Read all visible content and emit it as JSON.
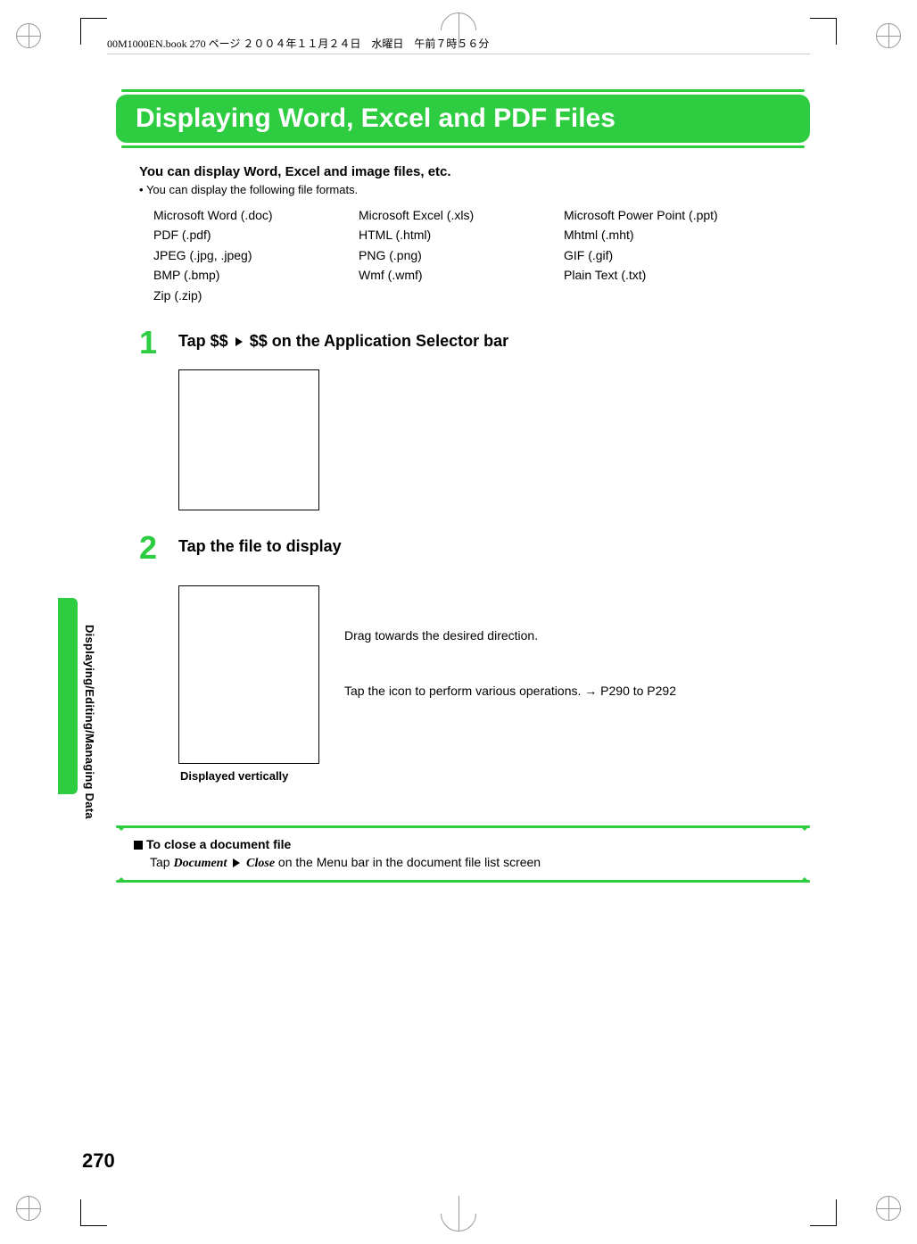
{
  "header": {
    "crop_text": "00M1000EN.book  270 ページ  ２００４年１１月２４日　水曜日　午前７時５６分"
  },
  "banner": {
    "title": "Displaying Word, Excel and PDF Files"
  },
  "intro": {
    "bold": "You can display Word, Excel and image files, etc.",
    "bullet_prefix": "•",
    "bullet_text": "You can display the following file formats."
  },
  "formats": {
    "col1": [
      "Microsoft Word (.doc)",
      "PDF (.pdf)",
      "JPEG (.jpg, .jpeg)",
      "BMP (.bmp)",
      "Zip (.zip)"
    ],
    "col2": [
      "Microsoft Excel (.xls)",
      "HTML (.html)",
      "PNG (.png)",
      "Wmf (.wmf)"
    ],
    "col3": [
      "Microsoft Power Point (.ppt)",
      "Mhtml (.mht)",
      "GIF (.gif)",
      "Plain Text (.txt)"
    ]
  },
  "steps": {
    "s1": {
      "num": "1",
      "pre": "Tap $$ ",
      "post": " $$ on the Application Selector bar"
    },
    "s2": {
      "num": "2",
      "text": "Tap the file to display",
      "right1": "Drag towards the desired direction.",
      "right2a": "Tap the icon to perform various operations. ",
      "right2b": " P290 to P292",
      "caption": "Displayed vertically"
    }
  },
  "note": {
    "heading": "To close a document file",
    "pre": "Tap ",
    "doc": "Document",
    "mid": " ",
    "close": "Close",
    "post": " on the Menu bar in the document file list screen"
  },
  "side": {
    "label": "Displaying/Editing/Managing Data"
  },
  "page_number": "270",
  "glyphs": {
    "arrow_right": "→"
  }
}
